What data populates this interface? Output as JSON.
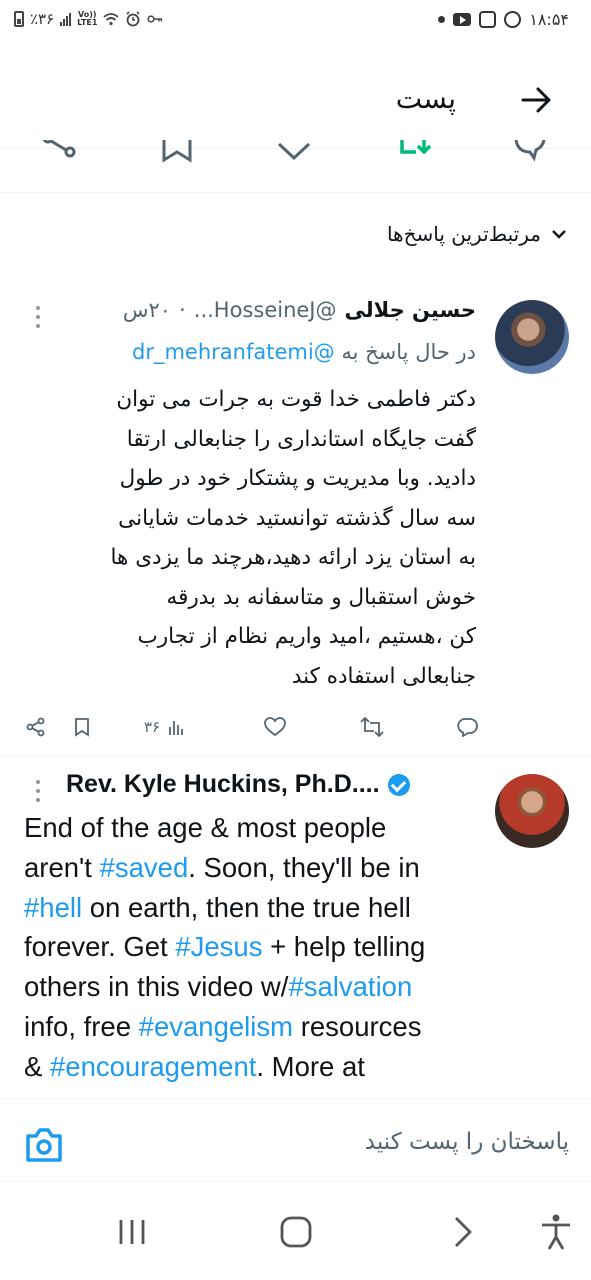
{
  "status_bar": {
    "battery_text": "٪۳۶",
    "lte_top": "Vo))",
    "lte_bottom": "LTE1",
    "time": "۱۸:۵۴",
    "icons": [
      "battery-icon",
      "signal-icon",
      "wifi-icon",
      "alarm-icon",
      "key-icon",
      "notification-dot-icon",
      "youtube-icon",
      "app-icon",
      "whatsapp-icon"
    ]
  },
  "header": {
    "title": "پست",
    "back_icon": "arrow-right-icon"
  },
  "sort": {
    "label": "مرتبط‌ترین پاسخ‌ها",
    "icon": "chevron-down-icon"
  },
  "tweet1": {
    "name": "حسین جلالی",
    "handle": "@HosseineJ...",
    "time": "۲۰س",
    "reply_prefix": "در حال پاسخ به",
    "reply_to": "@dr_mehranfatemi",
    "body": "دکتر فاطمی خدا قوت به جرات می توان\nگفت جایگاه استانداری را جنابعالی ارتقا\nدادید.  وبا مدیریت و پشتکار خود در طول\nسه سال گذشته توانستید خدمات شایانی\nبه استان یزد ارائه دهید،هرچند ما یزدی ها\nخوش استقبال و متاسفانه بد بدرقه\nکن ،هستیم ،امید واریم  نظام از تجارب\nجنابعالی استفاده کند",
    "views": "۳۶",
    "actions": [
      "share-icon",
      "bookmark-icon",
      "views-icon",
      "like-icon",
      "retweet-icon",
      "reply-icon"
    ]
  },
  "tweet2": {
    "name": "Rev. Kyle Huckins, Ph.D....",
    "lines": [
      [
        {
          "t": "End of the age & most people",
          "link": false
        }
      ],
      [
        {
          "t": "aren't ",
          "link": false
        },
        {
          "t": "#saved",
          "link": true
        },
        {
          "t": ". Soon, they'll be in",
          "link": false
        }
      ],
      [
        {
          "t": "#hell",
          "link": true
        },
        {
          "t": " on earth, then the true hell",
          "link": false
        }
      ],
      [
        {
          "t": "forever. Get ",
          "link": false
        },
        {
          "t": "#Jesus",
          "link": true
        },
        {
          "t": " + help telling",
          "link": false
        }
      ],
      [
        {
          "t": "others in this video w/",
          "link": false
        },
        {
          "t": "#salvation",
          "link": true
        }
      ],
      [
        {
          "t": "info, free ",
          "link": false
        },
        {
          "t": "#evangelism",
          "link": true
        },
        {
          "t": " resources",
          "link": false
        }
      ],
      [
        {
          "t": "& ",
          "link": false
        },
        {
          "t": "#encouragement",
          "link": true
        },
        {
          "t": ". More at",
          "link": false
        }
      ]
    ]
  },
  "reply_bar": {
    "placeholder": "پاسختان را پست کنید",
    "camera_icon": "camera-icon"
  },
  "nav_bar": {
    "icons": [
      "recents-icon",
      "home-icon",
      "back-icon",
      "accessibility-icon"
    ]
  },
  "colors": {
    "link": "#1d9bf0",
    "muted": "#536471",
    "retweet_green": "#00ba7c",
    "divider": "#eff3f4"
  }
}
